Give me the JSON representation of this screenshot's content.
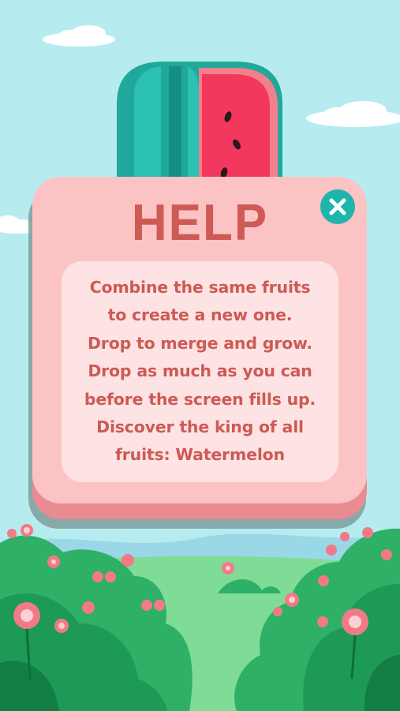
{
  "dialog": {
    "title": "HELP",
    "lines": [
      "Combine the same fruits",
      "to create a new one.",
      "Drop to merge and grow.",
      "Drop as much as you can",
      "before the screen fills up.",
      "Discover the king of all",
      "fruits: Watermelon"
    ]
  },
  "icons": {
    "close": "close-icon",
    "header_fruit": "watermelon-icon"
  },
  "colors": {
    "sky": "#b6ecef",
    "panel": "#fbc3c4",
    "panel_inner": "#fde3e3",
    "text": "#cd5a55",
    "close_button": "#1fb4ac",
    "bush": "#22a05a",
    "grass": "#7fdc97"
  }
}
